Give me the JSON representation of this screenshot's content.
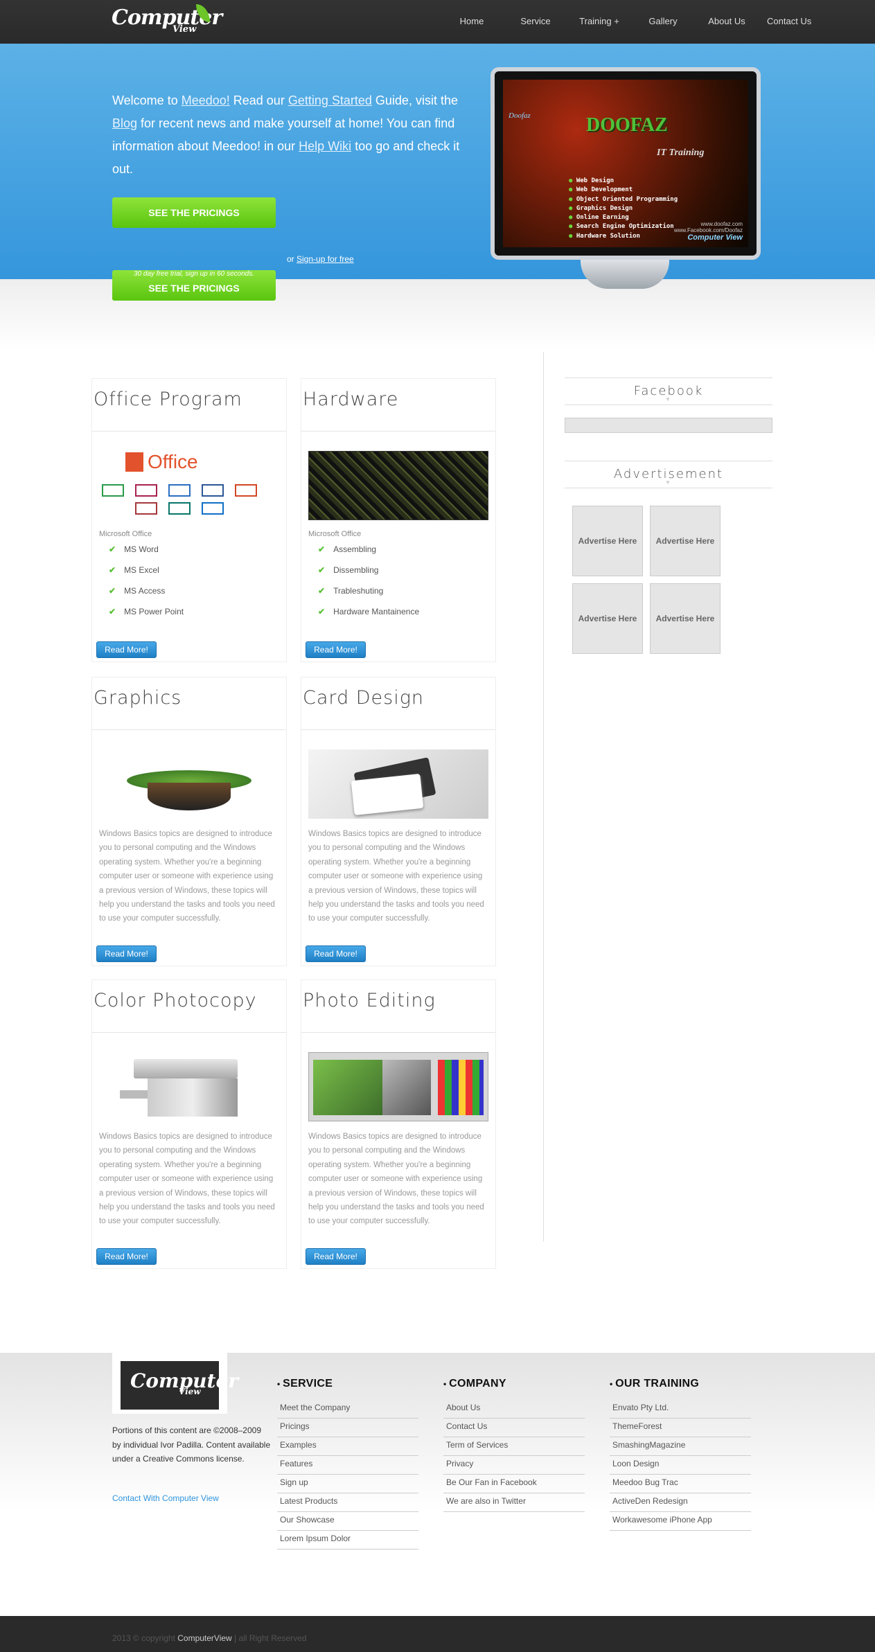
{
  "header": {
    "logo_main": "Computer",
    "logo_sub": "View",
    "nav": [
      "Home",
      "Service",
      "Training +",
      "Gallery",
      "About Us",
      "Contact Us"
    ]
  },
  "hero": {
    "parts": [
      "Welcome to ",
      "Meedoo!",
      " Read our ",
      "Getting Started",
      " Guide, visit the ",
      "Blog",
      " for recent news and make yourself at home! You can find information about Meedoo! in our ",
      "Help Wiki",
      " too go and check it out."
    ],
    "button_label": "SEE THE PRICINGS",
    "fine_print": "30 day free trial, sign up in 60 seconds.",
    "or_text": "or ",
    "signup_link": "Sign-up for free",
    "screen": {
      "logo": "Doofaz",
      "title": "DOOFAZ",
      "subtitle": "IT Training",
      "items": [
        "Web Design",
        "Web Development",
        "Object Oriented Programming",
        "Graphics Design",
        "Online Earning",
        "Search Engine Optimization",
        "Hardware Solution"
      ],
      "url1": "www.doofaz.com",
      "url2": "www.Facebook.com/Doofaz",
      "brand": "Computer View"
    }
  },
  "cards": [
    {
      "title": "Office Program",
      "caption": "Microsoft Office",
      "features": [
        "MS Word",
        "MS Excel",
        "MS Access",
        "MS Power Point"
      ],
      "button": "Read More!"
    },
    {
      "title": "Hardware",
      "caption": "Microsoft Office",
      "features": [
        "Assembling",
        "Dissembling",
        "Trableshuting",
        "Hardware Mantainence"
      ],
      "button": "Read More!"
    },
    {
      "title": "Graphics",
      "body": "Windows Basics topics are designed to introduce you to personal computing and the Windows operating system. Whether you're a beginning computer user or someone with experience using a previous version of Windows, these topics will help you understand the tasks and tools you need to use your computer successfully.",
      "button": "Read More!"
    },
    {
      "title": "Card Design",
      "body": "Windows Basics topics are designed to introduce you to personal computing and the Windows operating system. Whether you're a beginning computer user or someone with experience using a previous version of Windows, these topics will help you understand the tasks and tools you need to use your computer successfully.",
      "button": "Read More!"
    },
    {
      "title": "Color Photocopy",
      "body": "Windows Basics topics are designed to introduce you to personal computing and the Windows operating system. Whether you're a beginning computer user or someone with experience using a previous version of Windows, these topics will help you understand the tasks and tools you need to use your computer successfully.",
      "button": "Read More!"
    },
    {
      "title": "Photo Editing",
      "body": "Windows Basics topics are designed to introduce you to personal computing and the Windows operating system. Whether you're a beginning computer user or someone with experience using a previous version of Windows, these topics will help you understand the tasks and tools you need to use your computer successfully.",
      "button": "Read More!"
    }
  ],
  "office_logo": "Office",
  "sidebar": {
    "facebook_title": "Facebook",
    "ad_title": "Advertisement",
    "ads": [
      "Advertise Here",
      "Advertise Here",
      "Advertise Here",
      "Advertise Here"
    ]
  },
  "footer": {
    "about": "Portions of this content are ©2008–2009 by individual Ivor Padilla. Content available under a Creative Commons license.",
    "contact_link": "Contact With Computer View",
    "columns": [
      {
        "title": "SERVICE",
        "links": [
          "Meet the Company",
          "Pricings",
          "Examples",
          "Features",
          "Sign up",
          "Latest Products",
          "Our Showcase",
          "Lorem Ipsum Dolor"
        ]
      },
      {
        "title": "COMPANY",
        "links": [
          "About Us",
          "Contact Us",
          "Term of Services",
          "Privacy",
          "Be Our Fan in Facebook",
          "We are also in Twitter"
        ]
      },
      {
        "title": "OUR TRAINING",
        "links": [
          "Envato Pty Ltd.",
          "ThemeForest",
          "SmashingMagazine",
          "Loon Design",
          "Meedoo Bug Trac",
          "ActiveDen Redesign",
          "Workawesome iPhone App"
        ]
      }
    ]
  },
  "bottom": {
    "prefix": "2013 © copyright ",
    "brand": "ComputerView",
    "suffix": " | all Right Reserved"
  },
  "colors": {
    "accent": "#3596dc",
    "green": "#59c50f",
    "button_blue": "#1f7fc5"
  }
}
